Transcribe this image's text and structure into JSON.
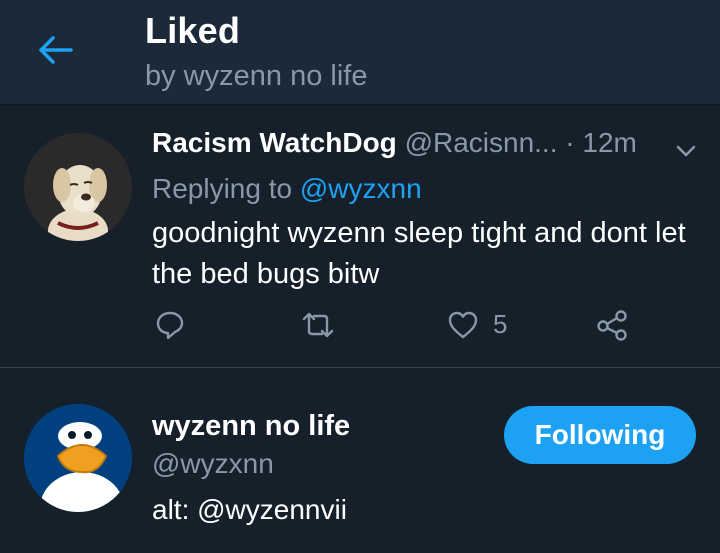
{
  "colors": {
    "background": "#15202b",
    "header_bg": "#1c2938",
    "accent": "#1da1f2",
    "secondary_text": "#8899a6",
    "primary_text": "#ffffff"
  },
  "header": {
    "back_icon": "arrow-left-icon",
    "title": "Liked",
    "subtitle": "by wyzenn no life"
  },
  "tweet": {
    "author_name": "Racism WatchDog",
    "author_handle": "@Racisnn...",
    "separator": "·",
    "time": "12m",
    "menu_icon": "chevron-down-icon",
    "replying_prefix": "Replying to",
    "replying_to": "@wyzxnn",
    "text": "goodnight wyzenn sleep tight and dont let the bed bugs bitw",
    "actions": {
      "reply_icon": "reply-icon",
      "retweet_icon": "retweet-icon",
      "like_icon": "heart-icon",
      "like_count": "5",
      "share_icon": "share-icon"
    }
  },
  "user": {
    "name": "wyzenn no life",
    "handle": "@wyzxnn",
    "bio": "alt: @wyzennvii",
    "follow_label": "Following"
  }
}
